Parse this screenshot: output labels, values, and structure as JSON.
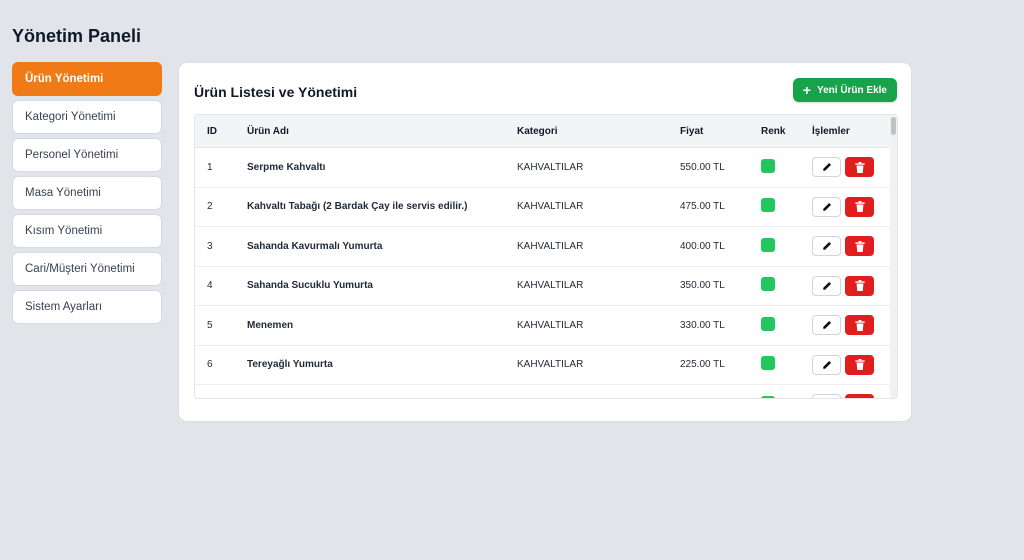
{
  "page_title": "Yönetim Paneli",
  "sidebar": {
    "items": [
      {
        "label": "Ürün Yönetimi"
      },
      {
        "label": "Kategori Yönetimi"
      },
      {
        "label": "Personel Yönetimi"
      },
      {
        "label": "Masa Yönetimi"
      },
      {
        "label": "Kısım Yönetimi"
      },
      {
        "label": "Cari/Müşteri Yönetimi"
      },
      {
        "label": "Sistem Ayarları"
      }
    ]
  },
  "card": {
    "title": "Ürün Listesi ve Yönetimi",
    "add_button_label": "Yeni Ürün Ekle"
  },
  "table": {
    "headers": {
      "id": "ID",
      "name": "Ürün Adı",
      "category": "Kategori",
      "price": "Fiyat",
      "color": "Renk",
      "actions": "İşlemler"
    },
    "rows": [
      {
        "id": "1",
        "name": "Serpme Kahvaltı",
        "category": "KAHVALTILAR",
        "price": "550.00 TL"
      },
      {
        "id": "2",
        "name": "Kahvaltı Tabağı (2 Bardak Çay ile servis edilir.)",
        "category": "KAHVALTILAR",
        "price": "475.00 TL"
      },
      {
        "id": "3",
        "name": "Sahanda Kavurmalı Yumurta",
        "category": "KAHVALTILAR",
        "price": "400.00 TL"
      },
      {
        "id": "4",
        "name": "Sahanda Sucuklu Yumurta",
        "category": "KAHVALTILAR",
        "price": "350.00 TL"
      },
      {
        "id": "5",
        "name": "Menemen",
        "category": "KAHVALTILAR",
        "price": "330.00 TL"
      },
      {
        "id": "6",
        "name": "Tereyağlı Yumurta",
        "category": "KAHVALTILAR",
        "price": "225.00 TL"
      },
      {
        "id": "",
        "name": "",
        "category": "",
        "price": ""
      }
    ]
  },
  "icons": {
    "add": "plus-icon",
    "edit": "pencil-icon",
    "delete": "trash-icon"
  },
  "colors": {
    "accent": "#ef7a16",
    "success": "#16a34a",
    "danger": "#e11d1d",
    "product_color": "#22c55e",
    "background": "#e1e4e8"
  }
}
